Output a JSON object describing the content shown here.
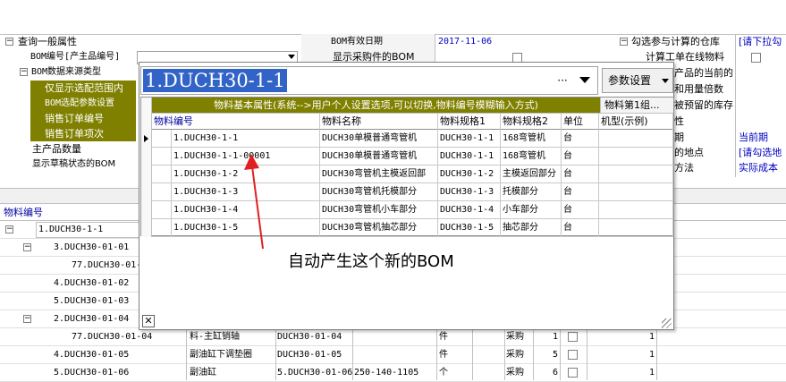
{
  "top_left": {
    "section_title": "查询一般属性",
    "bom_code_label": "BOM编号[产主品编号]",
    "data_source_title": "BOM数据来源类型",
    "olive_items": [
      "仅显示选配范围内",
      "BOM选配参数设置",
      "销售订单编号",
      "销售订单项次"
    ],
    "main_qty_label": "主产品数量",
    "draft_label": "显示草稿状态的BOM"
  },
  "top_mid": {
    "date_label": "BOM有效日期",
    "date_value": "2017-11-06",
    "purchase_label": "显示采购件的BOM"
  },
  "top_right": {
    "section_title": "勾选参与计算的仓库",
    "section_value": "[请下拉勾",
    "row2": "计算工单在线物料",
    "row3": "产品的当前的",
    "row4": "和用量倍数",
    "row5": "被预留的库存",
    "row6": "性",
    "row7_label": "期",
    "row7_value": "当前期",
    "row8_label": "的地点",
    "row8_value": "[请勾选地",
    "row9_label": "方法",
    "row9_value": "实际成本"
  },
  "tree": {
    "header": "物料编号",
    "rows": [
      {
        "code": "1.DUCH30-1-1",
        "name": "",
        "spec": "",
        "spec2": "",
        "unit": "",
        "src": "",
        "n1": "",
        "n2": ""
      },
      {
        "code": "3.DUCH30-01-01",
        "name": "",
        "spec": "",
        "spec2": "",
        "unit": "",
        "src": "",
        "n1": "",
        "n2": ""
      },
      {
        "code": "77.DUCH30-01-",
        "name": "",
        "spec": "",
        "spec2": "",
        "unit": "",
        "src": "",
        "n1": "",
        "n2": ""
      },
      {
        "code": "4.DUCH30-01-02",
        "name": "",
        "spec": "",
        "spec2": "",
        "unit": "",
        "src": "",
        "n1": "",
        "n2": ""
      },
      {
        "code": "5.DUCH30-01-03",
        "name": "",
        "spec": "",
        "spec2": "",
        "unit": "",
        "src": "",
        "n1": "",
        "n2": ""
      },
      {
        "code": "2.DUCH30-01-04",
        "name": "",
        "spec": "",
        "spec2": "",
        "unit": "",
        "src": "",
        "n1": "",
        "n2": ""
      },
      {
        "code": "77.DUCH30-01-04",
        "name": "料-主缸销轴",
        "spec": "DUCH30-01-04",
        "spec2": "",
        "unit": "件",
        "src": "采购",
        "n1": "1",
        "n2": "1"
      },
      {
        "code": "4.DUCH30-01-05",
        "name": "副油缸下调垫圈",
        "spec": "DUCH30-01-05",
        "spec2": "",
        "unit": "件",
        "src": "采购",
        "n1": "5",
        "n2": "1"
      },
      {
        "code": "5.DUCH30-01-06",
        "name": "副油缸",
        "spec": "5.DUCH30-01-06",
        "spec2": "250-140-1105",
        "unit": "个",
        "src": "采购",
        "n1": "6",
        "n2": "1"
      }
    ]
  },
  "dropdown": {
    "input_value": "1.DUCH30-1-1",
    "ellipsis": "···",
    "settings_label": "参数设置",
    "group_header": "物料基本属性(系统-->用户个人设置选项,可以切换,物料编号模糊输入方式)",
    "group_header2": "物料第1组...",
    "columns": [
      "物料编号",
      "物料名称",
      "物料规格1",
      "物料规格2",
      "单位",
      "机型(示例)"
    ],
    "rows": [
      {
        "code": "1.DUCH30-1-1",
        "name": "DUCH30单模普通弯管机",
        "spec1": "DUCH30-1-1",
        "spec2": "168弯管机",
        "unit": "台",
        "model": ""
      },
      {
        "code": "1.DUCH30-1-1-00001",
        "name": "DUCH30单模普通弯管机",
        "spec1": "DUCH30-1-1",
        "spec2": "168弯管机",
        "unit": "台",
        "model": ""
      },
      {
        "code": "1.DUCH30-1-2",
        "name": "DUCH30弯管机主模返回部",
        "spec1": "DUCH30-1-2",
        "spec2": "主模返回部分",
        "unit": "台",
        "model": ""
      },
      {
        "code": "1.DUCH30-1-3",
        "name": "DUCH30弯管机托模部分",
        "spec1": "DUCH30-1-3",
        "spec2": "托模部分",
        "unit": "台",
        "model": ""
      },
      {
        "code": "1.DUCH30-1-4",
        "name": "DUCH30弯管机小车部分",
        "spec1": "DUCH30-1-4",
        "spec2": "小车部分",
        "unit": "台",
        "model": ""
      },
      {
        "code": "1.DUCH30-1-5",
        "name": "DUCH30弯管机抽芯部分",
        "spec1": "DUCH30-1-5",
        "spec2": "抽芯部分",
        "unit": "台",
        "model": ""
      }
    ],
    "annotation": "自动产生这个新的BOM",
    "close_glyph": "✕"
  },
  "colors": {
    "olive": "#808000",
    "highlight": "#3264c8",
    "arrow": "#e02020"
  }
}
